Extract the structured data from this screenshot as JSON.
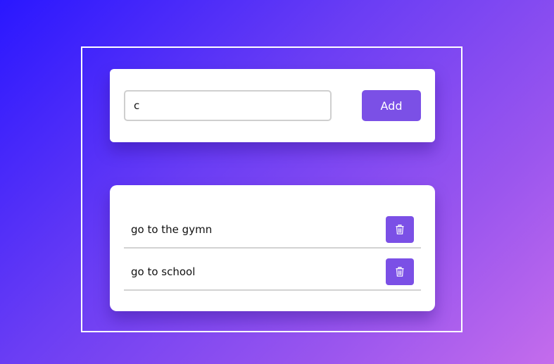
{
  "input_card": {
    "input_value": "c",
    "add_label": "Add"
  },
  "todos": [
    {
      "text": "go to the gymn",
      "delete_icon": "trash-icon"
    },
    {
      "text": "go to school",
      "delete_icon": "trash-icon"
    }
  ],
  "colors": {
    "accent": "#7b50e6",
    "background_start": "#2a17ff",
    "background_end": "#c46cec"
  }
}
